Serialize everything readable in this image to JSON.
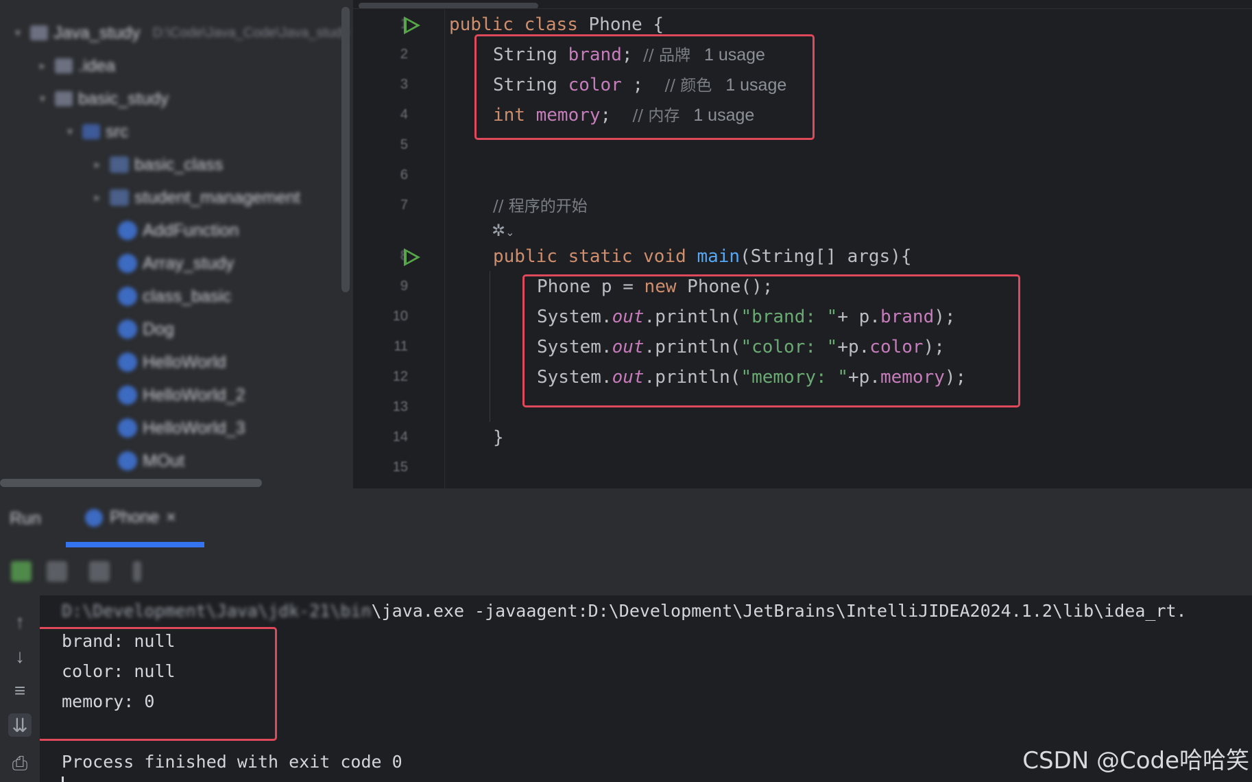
{
  "project": {
    "root": {
      "label": "Java_study",
      "hint": "D:\\Code\\Java_Code\\Java_study"
    },
    "items": [
      {
        "label": ".idea"
      },
      {
        "label": "basic_study"
      },
      {
        "label": "src"
      },
      {
        "label": "basic_class"
      },
      {
        "label": "student_management"
      },
      {
        "label": "AddFunction"
      },
      {
        "label": "Array_study"
      },
      {
        "label": "class_basic"
      },
      {
        "label": "Dog"
      },
      {
        "label": "HelloWorld"
      },
      {
        "label": "HelloWorld_2"
      },
      {
        "label": "HelloWorld_3"
      },
      {
        "label": "MOut"
      }
    ]
  },
  "editor": {
    "line_numbers": [
      "1",
      "2",
      "3",
      "4",
      "5",
      "6",
      "7",
      "8",
      "9",
      "10",
      "11",
      "12",
      "13",
      "14",
      "15"
    ],
    "code": {
      "l1": {
        "kw1": "public",
        "kw2": "class",
        "name": "Phone {"
      },
      "l2": {
        "type": "String",
        "field": "brand",
        "rest": ";",
        "comment": "// 品牌",
        "hint": "1 usage"
      },
      "l3": {
        "type": "String",
        "field": "color",
        "rest": " ;",
        "comment": "// 颜色",
        "hint": "1 usage"
      },
      "l4": {
        "type": "int",
        "field": "memory",
        "rest": ";",
        "comment": "// 内存",
        "hint": "1 usage"
      },
      "l7": {
        "comment": "// 程序的开始"
      },
      "l8": {
        "kw1": "public",
        "kw2": "static",
        "kw3": "void",
        "fn": "main",
        "rest": "(String[] args){"
      },
      "l9": {
        "pre": "Phone p = ",
        "kw": "new",
        "post": " Phone();"
      },
      "l10": {
        "pre": "System.",
        "out": "out",
        "call": ".println(",
        "str": "\"brand: \"",
        "mid": "+ p.",
        "field": "brand",
        "end": ");"
      },
      "l11": {
        "pre": "System.",
        "out": "out",
        "call": ".println(",
        "str": "\"color: \"",
        "mid": "+p.",
        "field": "color",
        "end": ");"
      },
      "l12": {
        "pre": "System.",
        "out": "out",
        "call": ".println(",
        "str": "\"memory: \"",
        "mid": "+p.",
        "field": "memory",
        "end": ");"
      },
      "l14": {
        "text": "}"
      }
    }
  },
  "tool_window": {
    "tab_run": "Run",
    "tab_phone": "Phone",
    "tab_close": "×"
  },
  "console": {
    "command_prefix": "D:\\Development\\Java\\jdk-21\\bin",
    "command": "\\java.exe -javaagent:D:\\Development\\JetBrains\\IntelliJIDEA2024.1.2\\lib\\idea_rt.",
    "out1": "brand: null",
    "out2": "color: null",
    "out3": "memory: 0",
    "finish": "Process finished with exit code 0"
  },
  "watermark": "CSDN @Code哈哈笑",
  "colors": {
    "highlight_box": "#e0485c",
    "run_icon": "#57a64a",
    "keyword": "#cf8e6d",
    "field": "#c77dbb",
    "string": "#6aab73",
    "function": "#56a8f5"
  }
}
